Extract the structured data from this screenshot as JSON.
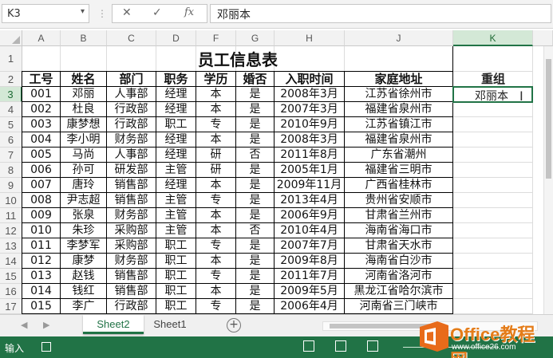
{
  "formula_bar": {
    "name_box": "K3",
    "cancel_icon": "✕",
    "enter_icon": "✓",
    "function_icon": "fx",
    "content": "邓丽本"
  },
  "columns": [
    "A",
    "B",
    "C",
    "D",
    "F",
    "G",
    "H",
    "J",
    "K"
  ],
  "rows": [
    "1",
    "2",
    "3",
    "4",
    "5",
    "6",
    "7",
    "8",
    "9",
    "10",
    "11",
    "12",
    "13",
    "14",
    "15",
    "16",
    "17"
  ],
  "title": "员工信息表",
  "headers": [
    "工号",
    "姓名",
    "部门",
    "职务",
    "学历",
    "婚否",
    "入职时间",
    "家庭地址"
  ],
  "extra_header": "重组",
  "active_cell_value": "邓丽本",
  "table_rows": [
    [
      "001",
      "邓丽",
      "人事部",
      "经理",
      "本",
      "是",
      "2008年3月",
      "江苏省徐州市"
    ],
    [
      "002",
      "杜良",
      "行政部",
      "经理",
      "本",
      "是",
      "2007年3月",
      "福建省泉州市"
    ],
    [
      "003",
      "康梦想",
      "行政部",
      "职工",
      "专",
      "是",
      "2010年9月",
      "江苏省镇江市"
    ],
    [
      "004",
      "李小明",
      "财务部",
      "经理",
      "本",
      "是",
      "2008年3月",
      "福建省泉州市"
    ],
    [
      "005",
      "马尚",
      "人事部",
      "经理",
      "研",
      "否",
      "2011年8月",
      "广东省潮州"
    ],
    [
      "006",
      "孙可",
      "研发部",
      "主管",
      "研",
      "是",
      "2005年1月",
      "福建省三明市"
    ],
    [
      "007",
      "唐玲",
      "销售部",
      "经理",
      "本",
      "是",
      "2009年11月",
      "广西省桂林市"
    ],
    [
      "008",
      "尹志超",
      "销售部",
      "主管",
      "专",
      "是",
      "2013年4月",
      "贵州省安顺市"
    ],
    [
      "009",
      "张泉",
      "财务部",
      "主管",
      "本",
      "是",
      "2006年9月",
      "甘肃省兰州市"
    ],
    [
      "010",
      "朱珍",
      "采购部",
      "主管",
      "本",
      "否",
      "2010年4月",
      "海南省海口市"
    ],
    [
      "011",
      "李梦军",
      "采购部",
      "职工",
      "专",
      "是",
      "2007年7月",
      "甘肃省天水市"
    ],
    [
      "012",
      "康梦",
      "财务部",
      "职工",
      "本",
      "是",
      "2009年8月",
      "海南省白沙市"
    ],
    [
      "013",
      "赵钱",
      "销售部",
      "职工",
      "专",
      "是",
      "2011年7月",
      "河南省洛河市"
    ],
    [
      "014",
      "钱红",
      "销售部",
      "职工",
      "本",
      "是",
      "2009年5月",
      "黑龙江省哈尔滨市"
    ],
    [
      "015",
      "李广",
      "行政部",
      "职工",
      "专",
      "是",
      "2006年4月",
      "河南省三门峡市"
    ]
  ],
  "tabs": {
    "sheets": [
      "Sheet2",
      "Sheet1"
    ],
    "active": "Sheet2",
    "add_icon": "+",
    "prev_icon": "◀",
    "next_icon": "▶"
  },
  "status": {
    "mode": "输入"
  },
  "watermark": {
    "brand": "Office教程网",
    "url": "www.office26.com"
  },
  "colors": {
    "accent": "#217346",
    "watermark_orange": "#e47c19"
  }
}
